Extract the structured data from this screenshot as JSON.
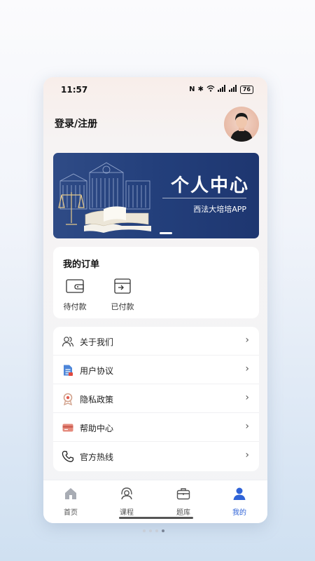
{
  "status_bar": {
    "time": "11:57",
    "battery": "76",
    "icons": [
      "nfc-icon",
      "bluetooth-icon",
      "wifi-icon",
      "signal-icon",
      "signal-icon"
    ]
  },
  "header": {
    "login_label": "登录/注册",
    "avatar": "avatar-icon"
  },
  "banner": {
    "title": "个人中心",
    "subtitle": "西法大培培APP",
    "colors": {
      "bg": "#233f7b"
    }
  },
  "orders": {
    "title": "我的订单",
    "items": [
      {
        "label": "待付款",
        "icon": "wallet-icon"
      },
      {
        "label": "已付款",
        "icon": "paid-card-icon"
      }
    ]
  },
  "menu": {
    "items": [
      {
        "label": "关于我们",
        "icon": "users-icon"
      },
      {
        "label": "用户协议",
        "icon": "document-icon"
      },
      {
        "label": "隐私政策",
        "icon": "privacy-badge-icon"
      },
      {
        "label": "帮助中心",
        "icon": "help-card-icon"
      },
      {
        "label": "官方热线",
        "icon": "phone-icon"
      }
    ]
  },
  "tabbar": {
    "items": [
      {
        "label": "首页",
        "icon": "home-icon"
      },
      {
        "label": "课程",
        "icon": "course-icon"
      },
      {
        "label": "题库",
        "icon": "briefcase-icon"
      },
      {
        "label": "我的",
        "icon": "profile-icon",
        "active": true
      }
    ],
    "active_color": "#2f63d7"
  }
}
